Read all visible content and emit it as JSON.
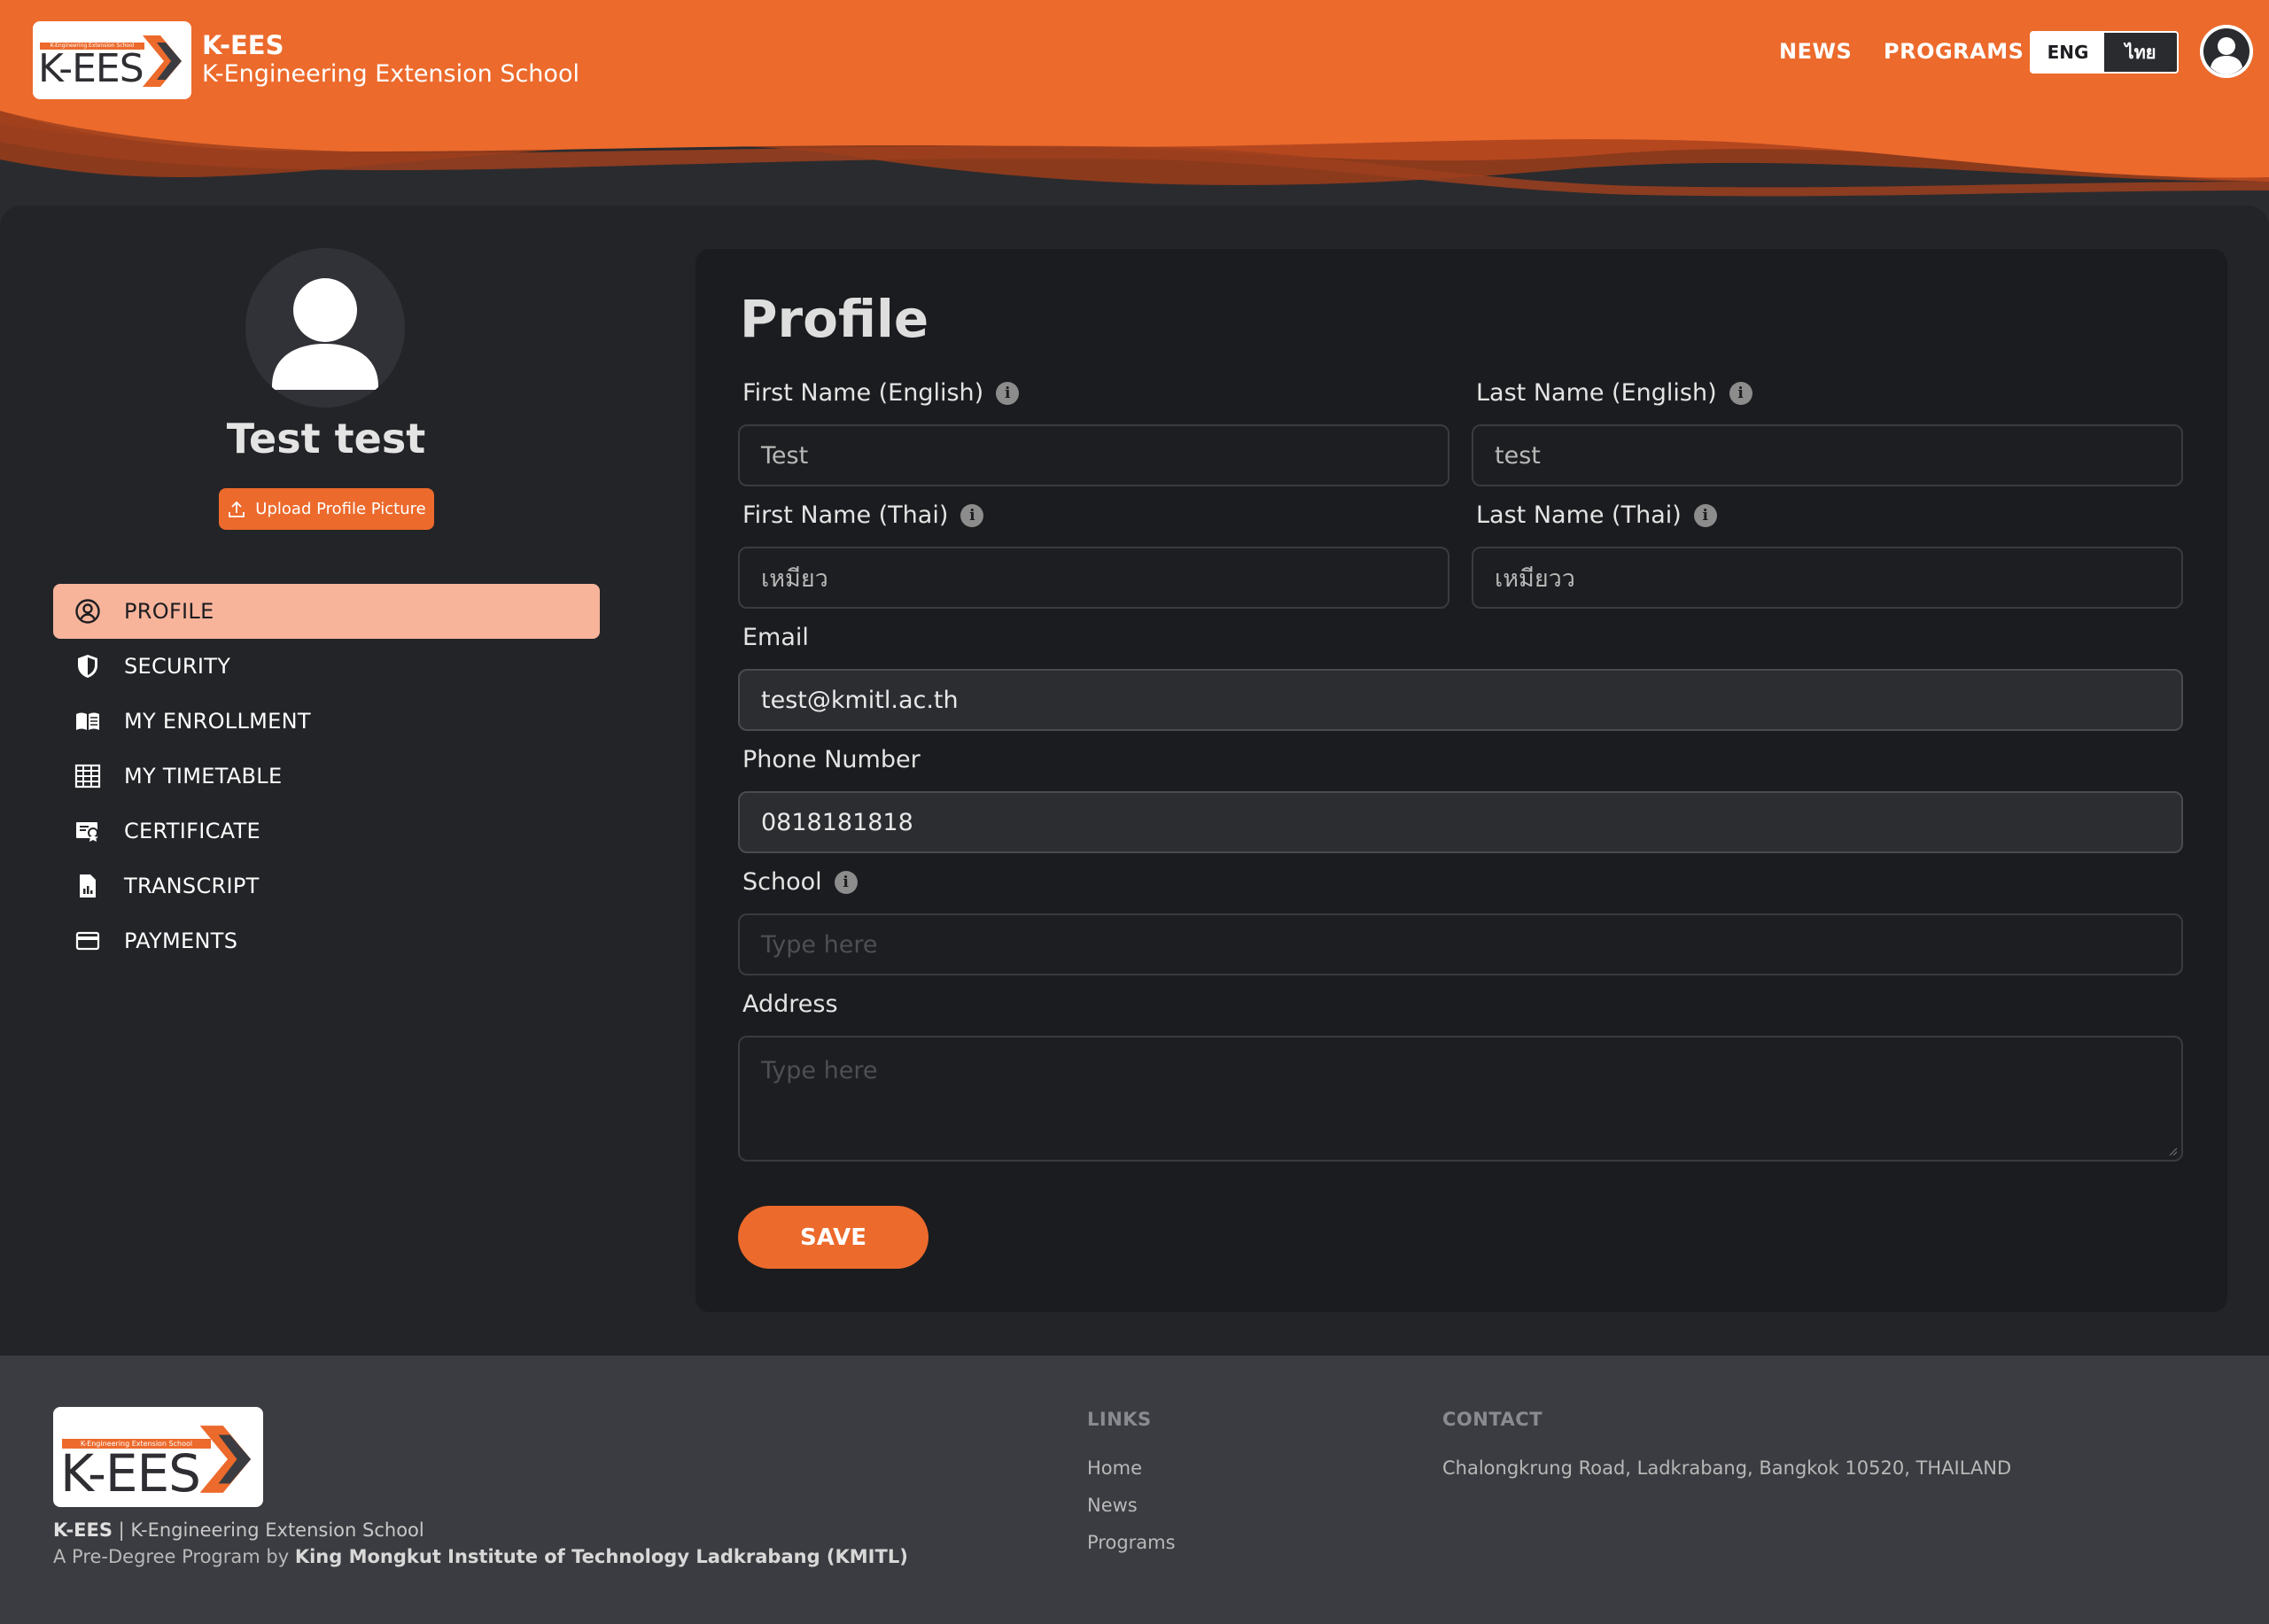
{
  "header": {
    "logo_small": "K-Engineering Extension School",
    "logo_main": "K-EES",
    "brand_name": "K-EES",
    "brand_subtitle": "K-Engineering Extension School",
    "nav": {
      "news": "NEWS",
      "programs": "PROGRAMS"
    },
    "lang": {
      "eng": "ENG",
      "th": "ไทย",
      "selected": "ENG"
    },
    "user_icon": "user-circle-icon"
  },
  "sidebar": {
    "user_name": "Test test",
    "upload_label": "Upload Profile Picture",
    "items": [
      {
        "label": "PROFILE",
        "icon": "user-circle-icon",
        "active": true
      },
      {
        "label": "SECURITY",
        "icon": "shield-icon",
        "active": false
      },
      {
        "label": "MY ENROLLMENT",
        "icon": "book-icon",
        "active": false
      },
      {
        "label": "MY TIMETABLE",
        "icon": "table-icon",
        "active": false
      },
      {
        "label": "CERTIFICATE",
        "icon": "certificate-icon",
        "active": false
      },
      {
        "label": "TRANSCRIPT",
        "icon": "document-chart-icon",
        "active": false
      },
      {
        "label": "PAYMENTS",
        "icon": "credit-card-icon",
        "active": false
      }
    ]
  },
  "form": {
    "title": "Profile",
    "first_name_en": {
      "label": "First Name (English)",
      "value": "Test"
    },
    "last_name_en": {
      "label": "Last Name (English)",
      "value": "test"
    },
    "first_name_th": {
      "label": "First Name (Thai)",
      "value": "เหมียว"
    },
    "last_name_th": {
      "label": "Last Name (Thai)",
      "value": "เหมียวว"
    },
    "email": {
      "label": "Email",
      "value": "test@kmitl.ac.th"
    },
    "phone": {
      "label": "Phone Number",
      "value": "0818181818"
    },
    "school": {
      "label": "School",
      "placeholder": "Type here"
    },
    "address": {
      "label": "Address",
      "placeholder": "Type here"
    },
    "save_label": "SAVE"
  },
  "footer": {
    "logo_small": "K-Engineering Extension School",
    "logo_main": "K-EES",
    "brand_bold": "K-EES",
    "brand_sep": " | ",
    "brand_rest": "K-Engineering Extension School",
    "program_prefix": "A Pre-Degree Program by ",
    "program_org": "King Mongkut Institute of Technology Ladkrabang (KMITL)",
    "links_heading": "LINKS",
    "links": [
      "Home",
      "News",
      "Programs"
    ],
    "contact_heading": "CONTACT",
    "contact_address": "Chalongkrung Road, Ladkrabang, Bangkok 10520, THAILAND"
  },
  "colors": {
    "accent": "#ec6a2c",
    "active_bg": "#f7b49b",
    "panel": "#232427",
    "card": "#1b1c1f"
  }
}
